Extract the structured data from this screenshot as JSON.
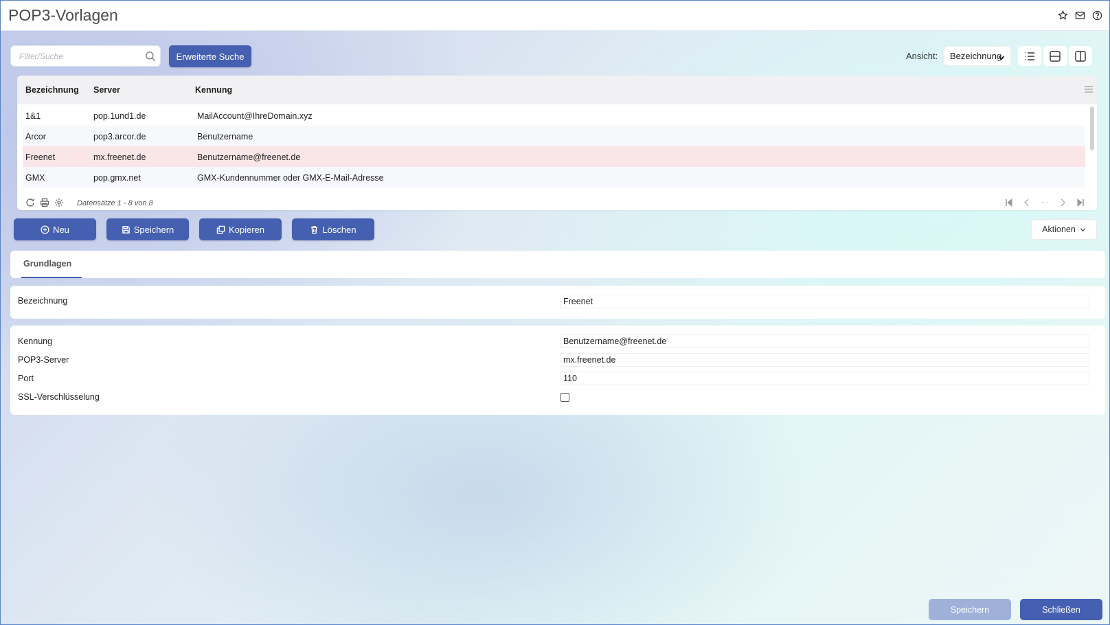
{
  "header": {
    "title": "POP3-Vorlagen"
  },
  "toolbar": {
    "search_placeholder": "Filter/Suche",
    "advanced_search_label": "Erweiterte Suche",
    "view_label": "Ansicht:",
    "view_selected": "Bezeichnung"
  },
  "grid": {
    "columns": [
      "Bezeichnung",
      "Server",
      "Kennung"
    ],
    "rows": [
      {
        "bezeichnung": "1&1",
        "server": "pop.1und1.de",
        "kennung": "MailAccount@IhreDomain.xyz"
      },
      {
        "bezeichnung": "Arcor",
        "server": "pop3.arcor.de",
        "kennung": "Benutzername"
      },
      {
        "bezeichnung": "Freenet",
        "server": "mx.freenet.de",
        "kennung": "Benutzername@freenet.de"
      },
      {
        "bezeichnung": "GMX",
        "server": "pop.gmx.net",
        "kennung": "GMX-Kundennummer oder GMX-E-Mail-Adresse"
      }
    ],
    "selected_index": 2,
    "record_count": "Datensätze 1 - 8 von 8",
    "pager_ellipsis": "···"
  },
  "actions": {
    "neu": "Neu",
    "speichern": "Speichern",
    "kopieren": "Kopieren",
    "loeschen": "Löschen",
    "aktionen": "Aktionen"
  },
  "tabs": [
    {
      "label": "Grundlagen",
      "active": true
    }
  ],
  "form": {
    "bezeichnung_label": "Bezeichnung",
    "bezeichnung_value": "Freenet",
    "kennung_label": "Kennung",
    "kennung_value": "Benutzername@freenet.de",
    "server_label": "POP3-Server",
    "server_value": "mx.freenet.de",
    "port_label": "Port",
    "port_value": "110",
    "ssl_label": "SSL-Verschlüsselung",
    "ssl_checked": false
  },
  "footer": {
    "save_label": "Speichern",
    "close_label": "Schließen"
  },
  "colors": {
    "primary": "#4560b0",
    "selected_row": "#fae6e6",
    "disabled": "#9fb1d8"
  }
}
